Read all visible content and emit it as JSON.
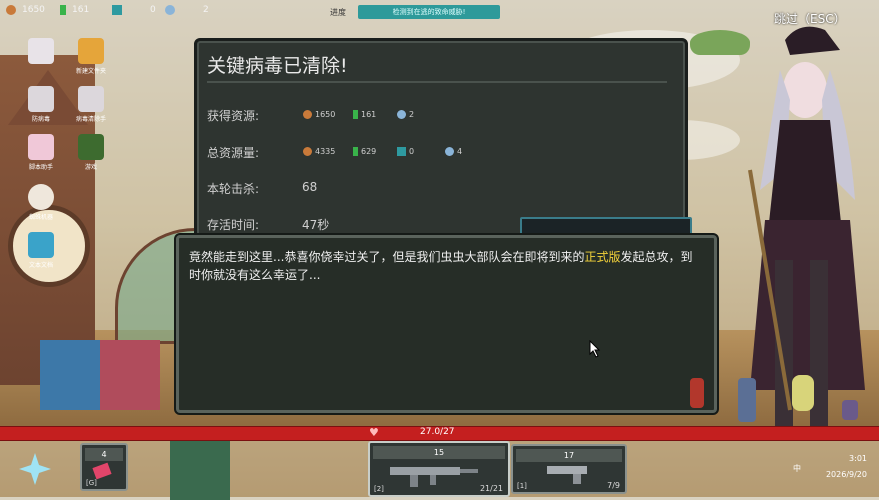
{
  "topbar": {
    "resources": [
      {
        "icon": "gear-icon",
        "value": "1650",
        "color": "#c97a3a"
      },
      {
        "icon": "battery-icon",
        "value": "161",
        "color": "#39b34a"
      },
      {
        "icon": "chip-icon",
        "value": "0",
        "color": "#2e9aa0"
      },
      {
        "icon": "speaker-icon",
        "value": "2",
        "color": "#8ab4d8"
      }
    ],
    "progress_label": "进度",
    "task_banner": "检测到在逃的致命威胁!",
    "skip_label": "跳过（ESC）"
  },
  "desktop_icons": [
    {
      "name": "skull-app-icon",
      "label": ""
    },
    {
      "name": "folder-icon",
      "label": "新建文件夹"
    },
    {
      "name": "gem-icon",
      "label": ""
    },
    {
      "name": "skull-launcher-icon",
      "label": "防病毒"
    },
    {
      "name": "skull-tool-icon",
      "label": "病毒清除手"
    },
    {
      "name": "skull-pink-icon",
      "label": "脚本助手"
    },
    {
      "name": "block-icon",
      "label": "游戏"
    },
    {
      "name": "ghost-icon",
      "label": "蜘蛛机器"
    },
    {
      "name": "document-icon",
      "label": "文本文档"
    }
  ],
  "results": {
    "title": "关键病毒已清除!",
    "gained_label": "获得资源:",
    "gained": [
      {
        "icon": "gear-icon",
        "value": "1650"
      },
      {
        "icon": "battery-icon",
        "value": "161"
      },
      {
        "icon": "speaker-icon",
        "value": "2"
      }
    ],
    "total_label": "总资源量:",
    "total": [
      {
        "icon": "gear-icon",
        "value": "4335"
      },
      {
        "icon": "battery-icon",
        "value": "629"
      },
      {
        "icon": "chip-icon",
        "value": "0"
      },
      {
        "icon": "speaker-icon",
        "value": "4"
      }
    ],
    "kills_label": "本轮击杀:",
    "kills_value": "68",
    "survive_label": "存活时间:",
    "survive_value": "47秒"
  },
  "dialog": {
    "text_before": "竟然能走到这里...恭喜你侥幸过关了，但是我们虫虫大部队会在即将到来的",
    "highlight": "正式版",
    "text_after": "发起总攻，到时你就没有这么幸运了..."
  },
  "hp": {
    "text": "27.0/27",
    "fraction": 1.0
  },
  "hud": {
    "item_slot": {
      "count": "4",
      "key": "[G]"
    },
    "weapon1": {
      "count": "15",
      "key": "[2]",
      "ammo": "21/21"
    },
    "weapon2": {
      "count": "17",
      "key": "[1]",
      "ammo": "7/9"
    },
    "lang": "中",
    "time": "3:01",
    "date": "2026/9/20"
  },
  "colors": {
    "accent": "#f3d23a",
    "hp": "#c41f1f",
    "banner": "#2e9a9a"
  }
}
